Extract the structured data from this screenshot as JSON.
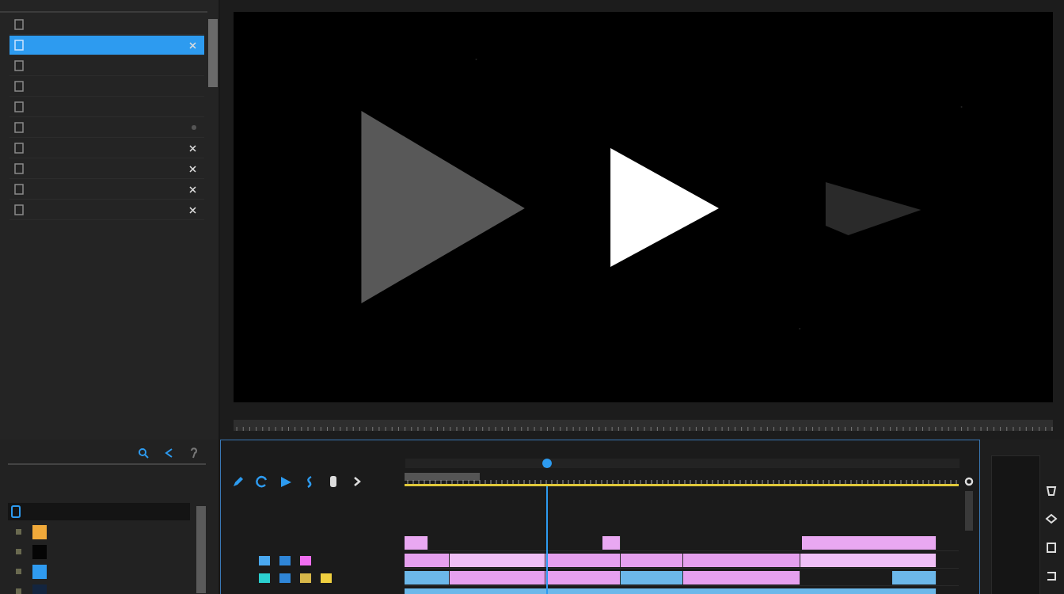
{
  "sidebar": {
    "items": [
      {
        "selected": false,
        "closable": false,
        "modified": false
      },
      {
        "selected": true,
        "closable": true,
        "modified": false
      },
      {
        "selected": false,
        "closable": false,
        "modified": false
      },
      {
        "selected": false,
        "closable": false,
        "modified": false
      },
      {
        "selected": false,
        "closable": false,
        "modified": false
      },
      {
        "selected": false,
        "closable": false,
        "modified": true
      },
      {
        "selected": false,
        "closable": true,
        "modified": false
      },
      {
        "selected": false,
        "closable": true,
        "modified": false
      },
      {
        "selected": false,
        "closable": true,
        "modified": false
      },
      {
        "selected": false,
        "closable": true,
        "modified": false
      }
    ]
  },
  "media_panel": {
    "items": [
      {
        "color": "#f0a93a",
        "expanded": false
      },
      {
        "color": "#050505",
        "expanded": false
      },
      {
        "color": "#2f9bf0",
        "expanded": false
      },
      {
        "color": "#13253f",
        "expanded": false
      }
    ]
  },
  "timeline": {
    "playhead": {
      "level": 0.255
    },
    "tracks": [
      {
        "clips": [
          {
            "color": "#e9a8f2"
          },
          {
            "color": "#e9a8f2"
          },
          {
            "color": "#e9a8f2"
          }
        ]
      },
      {
        "swatches": [
          {
            "color": "#4aa8f0"
          },
          {
            "color": "#2f86d8"
          },
          {
            "color": "#f06ef0"
          }
        ],
        "clips": [
          {
            "color": "#e6a0ef"
          },
          {
            "color": "#f0bff6"
          },
          {
            "color": "#e6a0ef"
          },
          {
            "color": "#e6a0ef"
          },
          {
            "color": "#e6a0ef"
          },
          {
            "color": "#f0bff6"
          }
        ]
      },
      {
        "swatches": [
          {
            "color": "#2bd0d0"
          },
          {
            "color": "#2f86d8"
          },
          {
            "color": "#d8b84a"
          },
          {
            "color": "#f0d040"
          }
        ],
        "clips": [
          {
            "color": "#6cb8ea"
          },
          {
            "color": "#e6a0ef"
          },
          {
            "color": "#e6a0ef"
          },
          {
            "color": "#6cb8ea"
          },
          {
            "color": "#e6a0ef"
          },
          {
            "color": "#6cb8ea"
          }
        ]
      },
      {
        "clips": [
          {
            "color": "#6cb8ea"
          }
        ]
      }
    ]
  }
}
